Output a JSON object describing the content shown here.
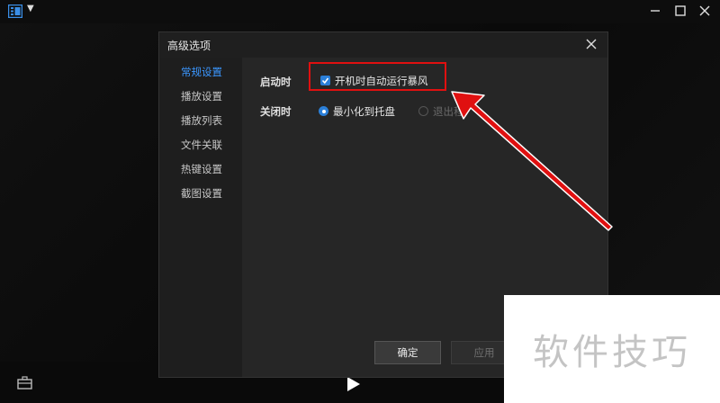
{
  "dialog": {
    "title": "高级选项",
    "nav": [
      "常规设置",
      "播放设置",
      "播放列表",
      "文件关联",
      "热键设置",
      "截图设置"
    ],
    "active_index": 0,
    "startup": {
      "label": "启动时",
      "checkbox_label": "开机时自动运行暴风",
      "checked": true
    },
    "close": {
      "label": "关闭时",
      "option1": "最小化到托盘",
      "option2": "退出程",
      "selected": 0
    },
    "buttons": {
      "ok": "确定",
      "apply": "应用"
    }
  },
  "watermark": "软件技巧",
  "colors": {
    "accent": "#2b7fd8",
    "active_nav": "#3b97ff",
    "highlight": "#e01010"
  },
  "icons": [
    "app-menu-icon",
    "minimize-icon",
    "maximize-icon",
    "close-icon",
    "tray-icon",
    "play-icon",
    "dialog-close-icon",
    "check-icon"
  ]
}
